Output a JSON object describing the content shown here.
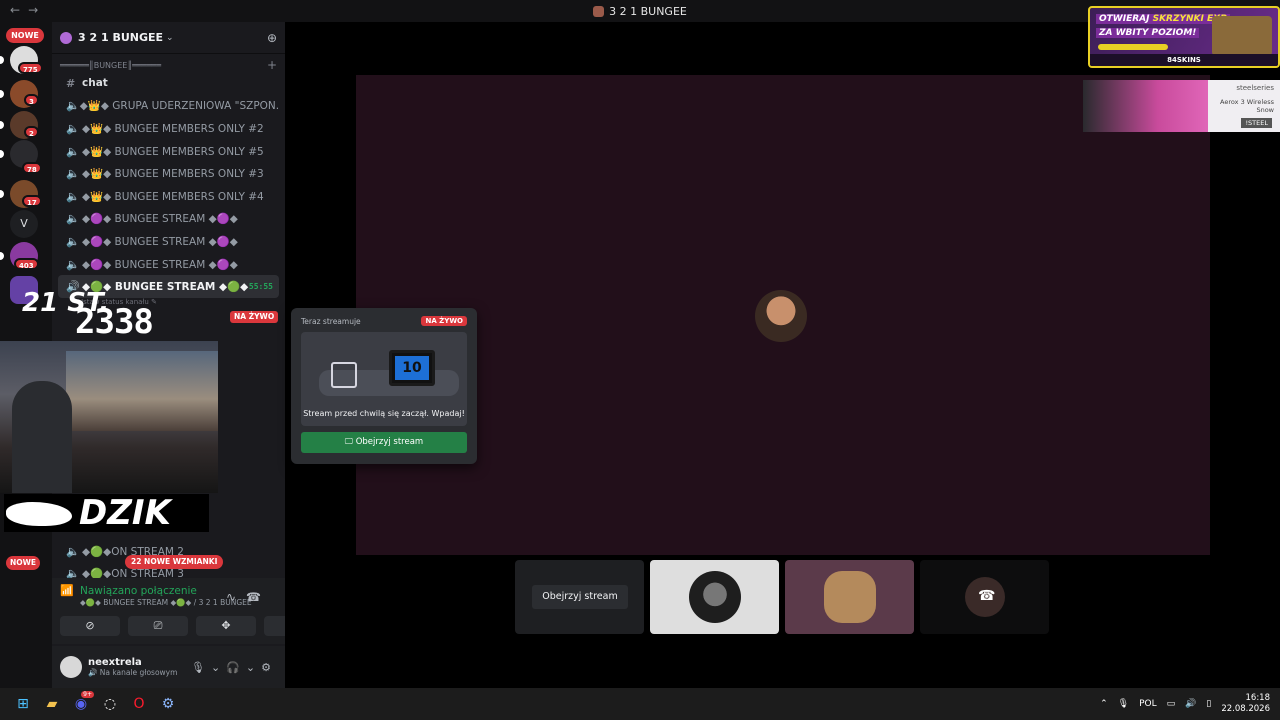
{
  "window": {
    "title": "3 2 1 BUNGEE",
    "nav_back": "←",
    "nav_forward": "→"
  },
  "rail": {
    "new_label": "NOWE",
    "badges": [
      "775",
      "3",
      "2",
      "78",
      "17",
      "403"
    ],
    "letter_server": "V",
    "bottom_new_label": "NOWE"
  },
  "server": {
    "name": "3 2 1 BUNGEE",
    "category": "══════║BUNGEE║══════",
    "text_channel": "chat",
    "channels": [
      "◆👑◆ GRUPA UDERZENIOWA \"SZPON...",
      "◆👑◆ BUNGEE MEMBERS ONLY #2",
      "◆👑◆ BUNGEE MEMBERS ONLY #5",
      "◆👑◆ BUNGEE MEMBERS ONLY #3",
      "◆👑◆ BUNGEE MEMBERS ONLY #4",
      "◆🟣◆ BUNGEE STREAM ◆🟣◆",
      "◆🟣◆ BUNGEE STREAM ◆🟣◆",
      "◆🟣◆ BUNGEE STREAM ◆🟣◆"
    ],
    "active_channel": "◆🟢◆ BUNGEE STREAM ◆🟢◆",
    "active_timer": "55:55",
    "status_hint": "Ustaw status kanału ✎",
    "on_stream_1": "◆🟢◆ON STREAM 2",
    "on_stream_2": "◆🟢◆ON STREAM 3",
    "live_label": "NA ŻYWO",
    "mentions": "22 NOWE WZMIANKI"
  },
  "overlay": {
    "logo_top": "21 ST.",
    "logo_number": "2338",
    "brand": "DZIK"
  },
  "voice": {
    "status": "Nawiązano połączenie",
    "detail": "◆🟢◆ BUNGEE STREAM ◆🟢◆ / 3 2 1 BUNGEE"
  },
  "user": {
    "name": "neextrela",
    "status": "🔊 Na kanale głosowym"
  },
  "popup": {
    "header": "Teraz streamuje",
    "live": "NA ŻYWO",
    "tv_number": "10",
    "message": "Stream przed chwilą się zaczął. Wpadaj!",
    "watch": "Obejrzyj stream"
  },
  "tiles": {
    "watch_label": "Obejrzyj stream"
  },
  "ads": {
    "ad1_line1_a": "OTWIERAJ ",
    "ad1_line1_b": "SKRZYNKI EXP",
    "ad1_line2": "ZA WBITY POZIOM!",
    "ad1_logo": "84SKINS",
    "ad2_brand": "steelseries",
    "ad2_product": "Aerox 3 Wireless Snow",
    "ad2_tag": "!STEEL"
  },
  "taskbar": {
    "discord_badge": "9+",
    "lang": "POL",
    "time": "16:18",
    "date": "22.08.2026"
  }
}
